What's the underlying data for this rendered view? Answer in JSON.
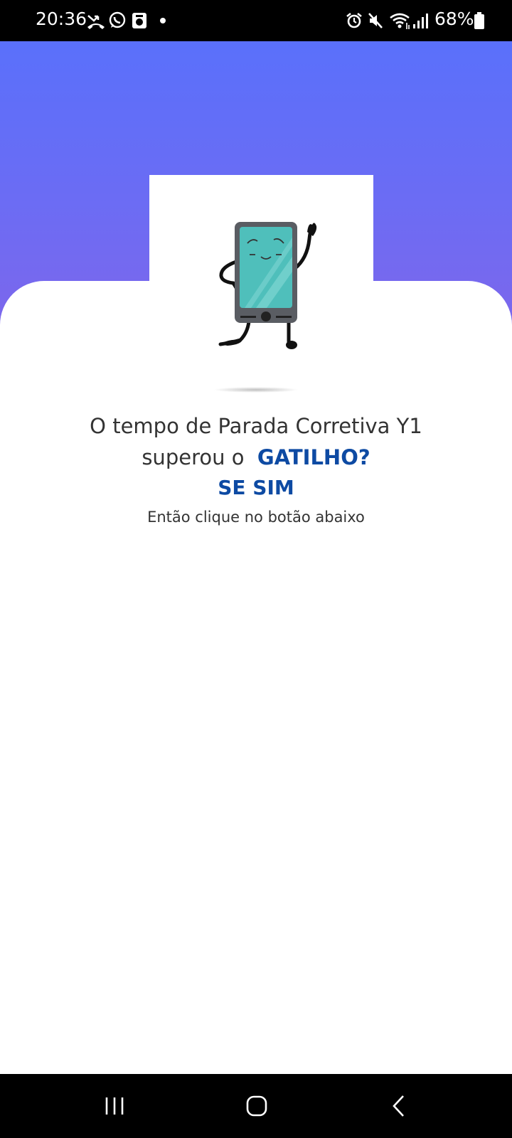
{
  "status_bar": {
    "time": "20:36",
    "battery_percent": "68%",
    "icons_left": [
      "missed-call-icon",
      "whatsapp-icon",
      "app-notification-icon",
      "dot-icon"
    ],
    "icons_right": [
      "alarm-icon",
      "mute-icon",
      "wifi-icon",
      "signal-icon",
      "battery-icon"
    ]
  },
  "colors": {
    "header_top": "#5a70fb",
    "header_bottom": "#7c67ec",
    "accent_blue": "#0d4aa3",
    "phone_screen": "#4fbfbb"
  },
  "message": {
    "line1": "O tempo de Parada Corretiva Y1",
    "line2_prefix": "superou o",
    "line2_highlight": "GATILHO?",
    "line3": "SE SIM",
    "instruction": "Então clique no botão abaixo"
  },
  "hero": {
    "illustration": "waving-phone-character"
  },
  "nav_bar": {
    "buttons": [
      "recent-apps-icon",
      "home-icon",
      "back-icon"
    ]
  }
}
